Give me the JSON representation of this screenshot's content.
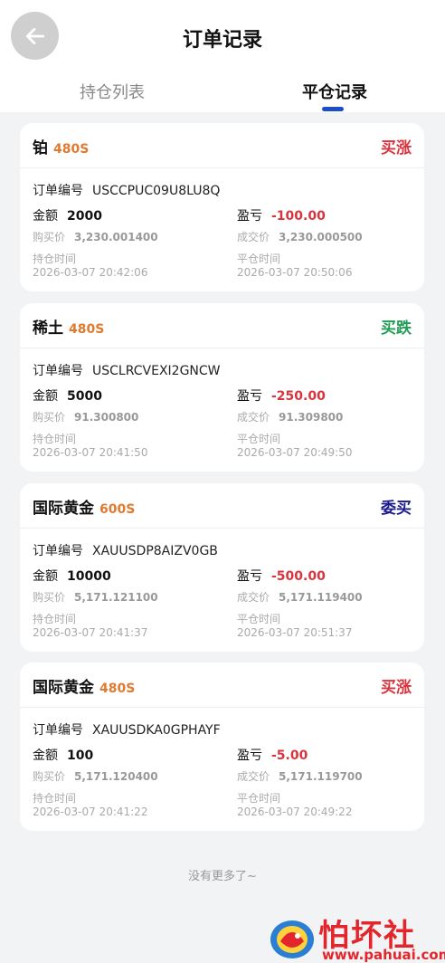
{
  "header": {
    "title": "订单记录"
  },
  "tabs": [
    {
      "label": "持仓列表",
      "active": false
    },
    {
      "label": "平仓记录",
      "active": true
    }
  ],
  "labels": {
    "order_no": "订单编号",
    "amount": "金额",
    "pnl": "盈亏",
    "buy_price": "购买价",
    "deal_price": "成交价",
    "hold_time": "持仓时间",
    "close_time": "平仓时间"
  },
  "orders": [
    {
      "product": "铂",
      "duration": "480S",
      "direction": "买涨",
      "direction_color": "#d9343e",
      "order_no": "USCCPUC09U8LU8Q",
      "amount": "2000",
      "pnl": "-100.00",
      "buy_price": "3,230.001400",
      "deal_price": "3,230.000500",
      "hold_time": "2026-03-07 20:42:06",
      "close_time": "2026-03-07 20:50:06"
    },
    {
      "product": "稀土",
      "duration": "480S",
      "direction": "买跌",
      "direction_color": "#1f9d55",
      "order_no": "USCLRCVEXI2GNCW",
      "amount": "5000",
      "pnl": "-250.00",
      "buy_price": "91.300800",
      "deal_price": "91.309800",
      "hold_time": "2026-03-07 20:41:50",
      "close_time": "2026-03-07 20:49:50"
    },
    {
      "product": "国际黄金",
      "duration": "600S",
      "direction": "委买",
      "direction_color": "#1a1a8c",
      "order_no": "XAUUSDP8AIZV0GB",
      "amount": "10000",
      "pnl": "-500.00",
      "buy_price": "5,171.121100",
      "deal_price": "5,171.119400",
      "hold_time": "2026-03-07 20:41:37",
      "close_time": "2026-03-07 20:51:37"
    },
    {
      "product": "国际黄金",
      "duration": "480S",
      "direction": "买涨",
      "direction_color": "#d9343e",
      "order_no": "XAUUSDKA0GPHAYF",
      "amount": "100",
      "pnl": "-5.00",
      "buy_price": "5,171.120400",
      "deal_price": "5,171.119700",
      "hold_time": "2026-03-07 20:41:22",
      "close_time": "2026-03-07 20:49:22"
    }
  ],
  "footer": {
    "no_more": "没有更多了~"
  },
  "watermark": {
    "text": "怕坏社区",
    "url": "www.pahuai.com"
  },
  "icons": {
    "back": "arrow-left-icon"
  }
}
